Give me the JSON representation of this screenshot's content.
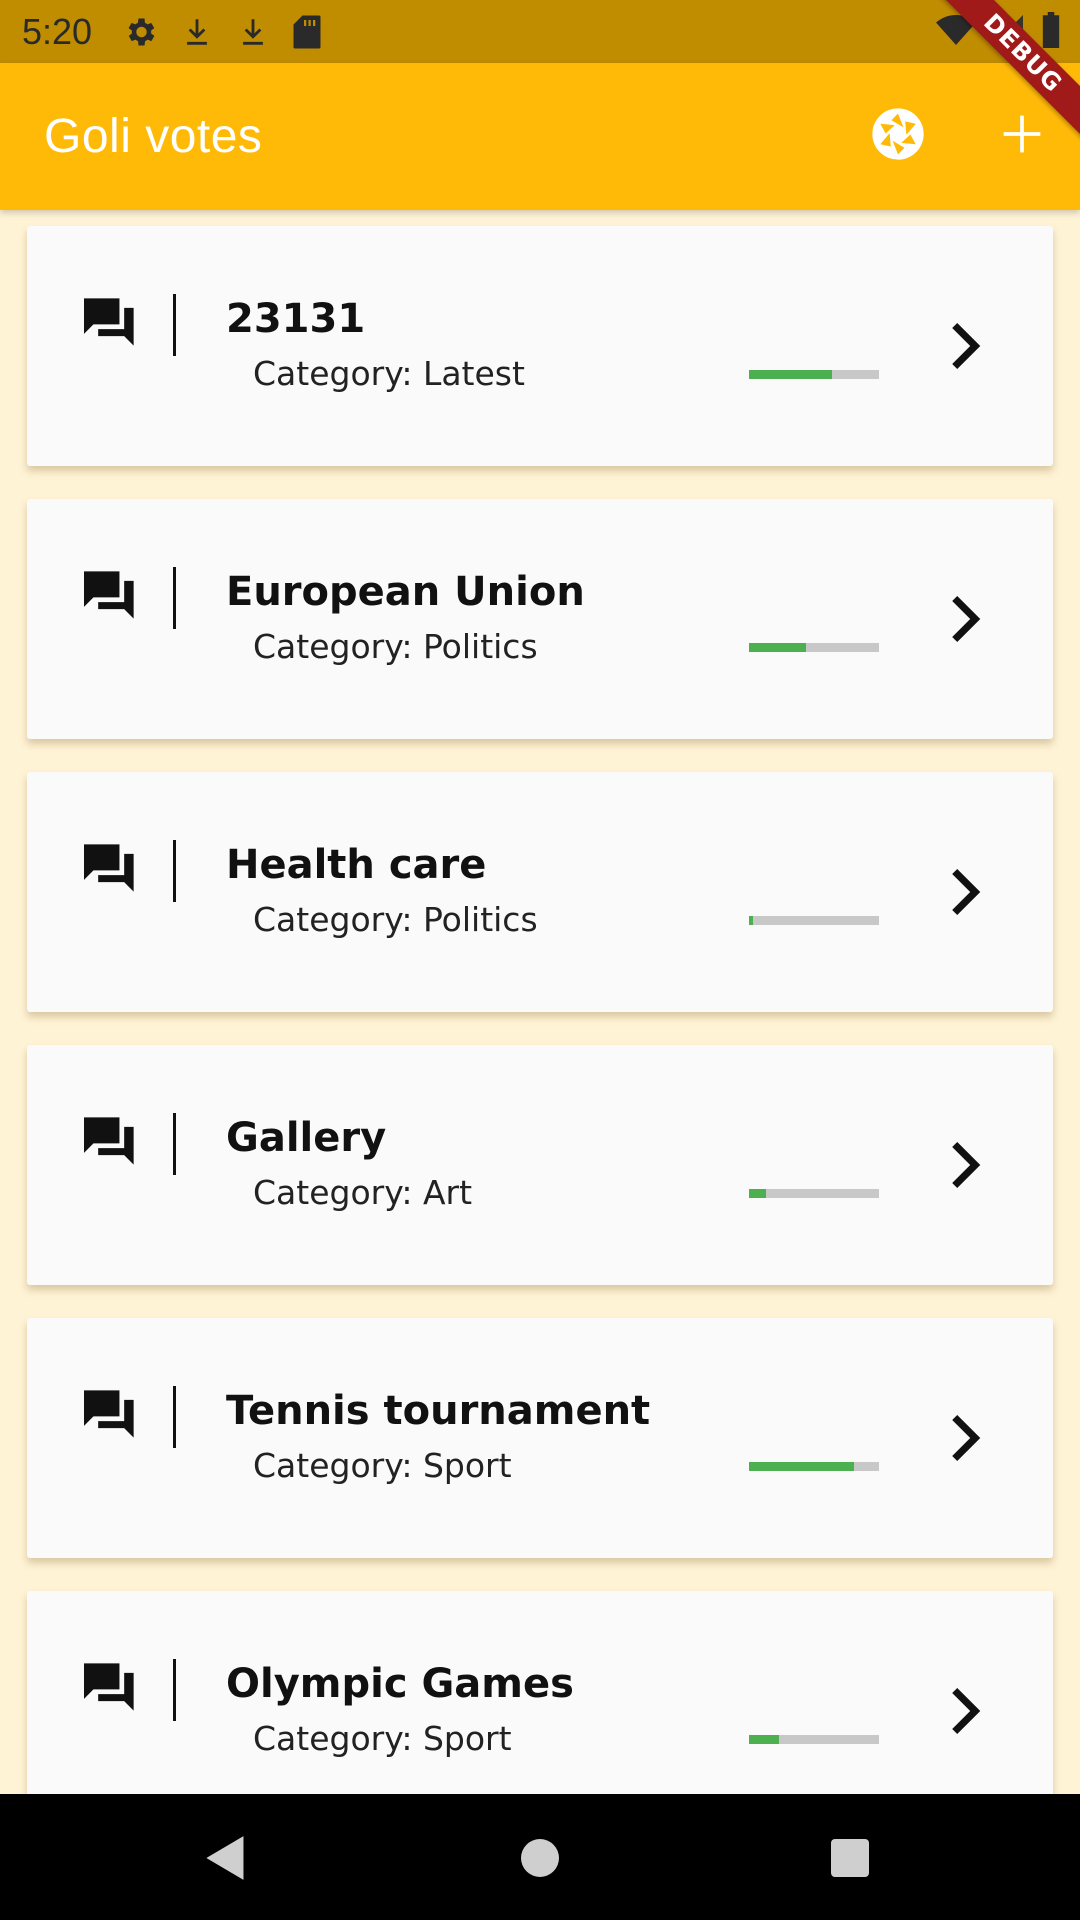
{
  "status_bar": {
    "time": "5:20",
    "left_icons": [
      "settings-icon",
      "download-icon",
      "download-icon",
      "sd-card-icon"
    ],
    "right_icons": [
      "wifi-icon",
      "signal-icon",
      "battery-icon"
    ]
  },
  "debug_banner": "DEBUG",
  "app_bar": {
    "title": "Goli votes",
    "actions": [
      "camera-shutter-icon",
      "add-icon"
    ]
  },
  "votes": [
    {
      "title": "23131",
      "category": "Category: Latest",
      "progress": 0.64
    },
    {
      "title": "European Union",
      "category": "Category: Politics",
      "progress": 0.44
    },
    {
      "title": "Health care",
      "category": "Category: Politics",
      "progress": 0.03
    },
    {
      "title": "Gallery",
      "category": "Category: Art",
      "progress": 0.13
    },
    {
      "title": "Tennis tournament",
      "category": "Category: Sport",
      "progress": 0.81
    },
    {
      "title": "Olympic Games",
      "category": "Category: Sport",
      "progress": 0.23
    }
  ],
  "colors": {
    "app_bar": "#FFBA08",
    "status_bar": "#C08C00",
    "background": "#FFF3D6",
    "progress_fill": "#4CAF50",
    "progress_track": "#C8C8C8"
  },
  "nav_bar": [
    "back-icon",
    "home-icon",
    "recents-icon"
  ]
}
